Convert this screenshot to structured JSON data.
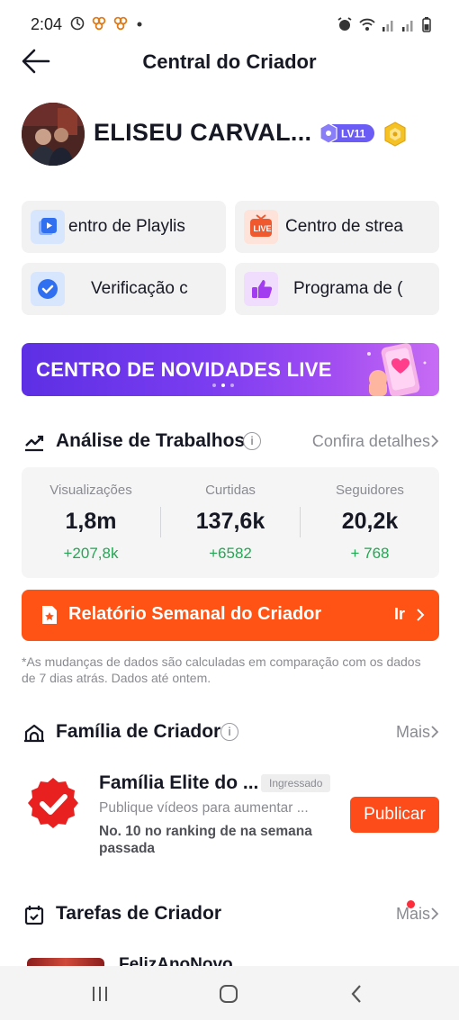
{
  "status_bar": {
    "time": "2:04",
    "left_icons": [
      "data-saver-icon",
      "app-notification-icon",
      "app-notification-icon",
      "dot-icon"
    ],
    "right_icons": [
      "alarm-icon",
      "wifi-icon",
      "signal-icon",
      "signal-icon",
      "battery-icon"
    ]
  },
  "header": {
    "title": "Central do Criador",
    "back_icon": "arrow-left-icon"
  },
  "profile": {
    "name": "ELISEU CARVAL...",
    "level": "LV11",
    "level_color": "#6b5cf5",
    "badge_icon": "hexagon-badge-icon"
  },
  "tools": [
    {
      "label": "entro de Playlis",
      "icon": "playlist-icon",
      "color": "#2f6ff0"
    },
    {
      "label": "Centro de strea",
      "icon": "live-icon",
      "color": "#f0582e"
    },
    {
      "label": "Verificação c",
      "icon": "verified-icon",
      "color": "#2f6ff0"
    },
    {
      "label": "Programa de (",
      "icon": "thumbs-up-icon",
      "color": "#a33cf0"
    }
  ],
  "banner": {
    "text": "CENTRO DE NOVIDADES LIVE",
    "active_dot": 1,
    "dots": 3
  },
  "analytics": {
    "title": "Análise de Trabalhos",
    "link": "Confira detalhes",
    "stats": [
      {
        "label": "Visualizações",
        "value": "1,8m",
        "delta": "+207,8k"
      },
      {
        "label": "Curtidas",
        "value": "137,6k",
        "delta": "+6582"
      },
      {
        "label": "Seguidores",
        "value": "20,2k",
        "delta": "+ 768"
      }
    ],
    "delta_color": "#20a952"
  },
  "weekly_report": {
    "label": "Relatório Semanal do Criador",
    "go": "Ir",
    "color": "#fe5314"
  },
  "note": "*As mudanças de dados são calculadas em comparação com os dados de 7 dias atrás. Dados até ontem.",
  "family": {
    "title": "Família de Criador",
    "more": "Mais",
    "item_title": "Família Elite do ...",
    "tag": "Ingressado",
    "subtitle": "Publique vídeos para aumentar ...",
    "rank": "No. 10 no ranking de na semana passada",
    "publish": "Publicar"
  },
  "tasks": {
    "title": "Tarefas de Criador",
    "more": "Mais",
    "peek_name": "FelizAnoNovo"
  },
  "system_nav": [
    "recents-icon",
    "home-icon",
    "back-chevron-icon"
  ]
}
